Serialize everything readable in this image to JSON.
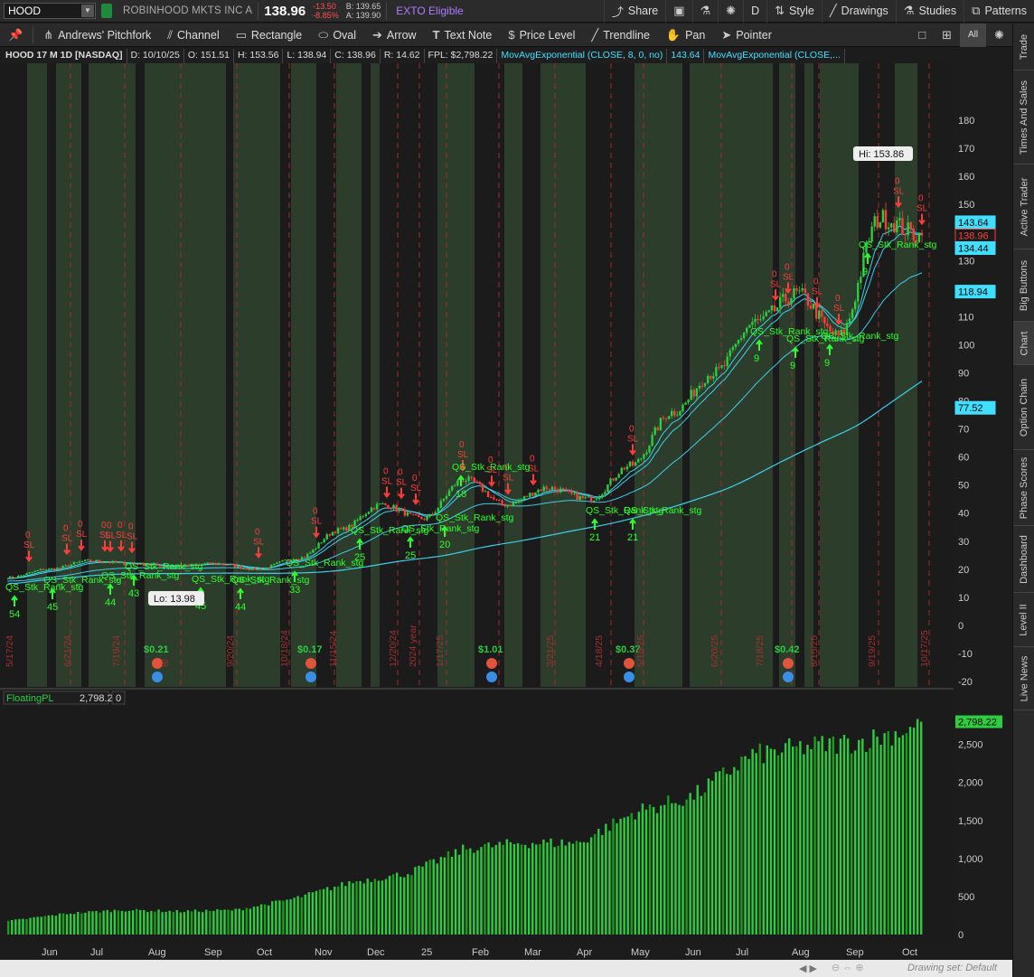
{
  "header": {
    "symbol": "HOOD",
    "company": "ROBINHOOD MKTS INC A",
    "last": "138.96",
    "change": "-13.50",
    "change_pct": "-8.85%",
    "bid": "B: 139.65",
    "ask": "A: 139.90",
    "exto": "EXTO Eligible",
    "buttons": [
      "Share",
      "Style",
      "Drawings",
      "Studies",
      "Patterns"
    ],
    "period_btn": "D"
  },
  "drawing_tools": [
    "Andrews' Pitchfork",
    "Channel",
    "Rectangle",
    "Oval",
    "Arrow",
    "Text Note",
    "Price Level",
    "Trendline",
    "Pan",
    "Pointer"
  ],
  "view_buttons": {
    "all": "All"
  },
  "info": {
    "title": "HOOD 17 M 1D [NASDAQ]",
    "date": "D: 10/10/25",
    "open": "O: 151.51",
    "high": "H: 153.56",
    "low": "L: 138.94",
    "close": "C: 138.96",
    "range": "R: 14.62",
    "fpl": "FPL: $2,798.22",
    "ma1": "MovAvgExponential (CLOSE, 8, 0, no)",
    "ma1_val": "143.64",
    "ma2": "MovAvgExponential (CLOSE,..."
  },
  "right_tabs": [
    "Trade",
    "Times And Sales",
    "Active Trader",
    "Big Buttons",
    "Chart",
    "Option Chain",
    "Phase Scores",
    "Dashboard",
    "Level II",
    "Live News"
  ],
  "active_tab": "Chart",
  "price_labels": {
    "ema8": "143.64",
    "last": "138.96",
    "ema13": "134.44",
    "ema21": "118.94",
    "sma200": "77.52",
    "hi": "Hi: 153.86",
    "lo": "Lo: 13.98"
  },
  "events": {
    "dividends": [
      "$0.21",
      "$0.17",
      "$1.01",
      "$0.37",
      "$0.42"
    ]
  },
  "lower_panel": {
    "name": "FloatingPL",
    "value": "2,798.22",
    "zero": "0"
  },
  "x_date_labels": [
    "5/17/24",
    "6/21/24",
    "7/19/24",
    "8/",
    "9/20/24",
    "10/18/24",
    "11/15/24",
    "12/20/24",
    "2024 year",
    "1/17/25",
    "3/21/25",
    "4/18/25",
    "5/16/25",
    "6/20/25",
    "7/18/25",
    "8/15/25",
    "9/19/25",
    "10/17/25"
  ],
  "signal_label": "QS_Stk_Rank_stg",
  "sl_label": "SL",
  "zero_label": "0",
  "status": {
    "drawing_set": "Drawing set: Default"
  },
  "colors": {
    "up": "#2ecc40",
    "down": "#ff3b3b",
    "ema": "#3fe0ff",
    "signal": "#2bff2b",
    "shade": "#334a33"
  },
  "chart_data": [
    {
      "type": "line",
      "title": "HOOD 17 M 1D [NASDAQ]",
      "ylim": [
        -20,
        190
      ],
      "y_ticks": [
        -20,
        -10,
        0,
        10,
        20,
        30,
        40,
        50,
        60,
        70,
        80,
        90,
        100,
        110,
        120,
        130,
        140,
        150,
        160,
        170,
        180
      ],
      "x": [
        "May",
        "Jun",
        "Jul",
        "Aug",
        "Sep",
        "Oct",
        "Nov",
        "Dec",
        "25",
        "Feb",
        "Mar",
        "Apr",
        "May",
        "Jun",
        "Jul",
        "Aug",
        "Sep",
        "Oct"
      ],
      "series": [
        {
          "values": [
            17,
            20,
            23,
            22,
            21,
            22,
            20,
            24,
            34,
            43,
            38,
            52,
            43,
            49,
            45,
            57,
            76,
            90,
            108,
            118,
            103,
            145,
            138.96
          ]
        }
      ]
    },
    {
      "type": "bar",
      "title": "FloatingPL",
      "ylim": [
        0,
        2900
      ],
      "y_ticks": [
        0,
        500,
        1000,
        1500,
        2000,
        2500
      ],
      "x": [
        "Jun",
        "Jul",
        "Aug",
        "Sep",
        "Oct",
        "Nov",
        "Dec",
        "25",
        "Feb",
        "Mar",
        "Apr",
        "May",
        "Jun",
        "Jul",
        "Aug",
        "Sep",
        "Oct"
      ],
      "values": [
        180,
        280,
        330,
        310,
        330,
        480,
        700,
        820,
        1150,
        1230,
        1230,
        1650,
        1850,
        2400,
        2520,
        2600,
        2798.22
      ]
    }
  ]
}
